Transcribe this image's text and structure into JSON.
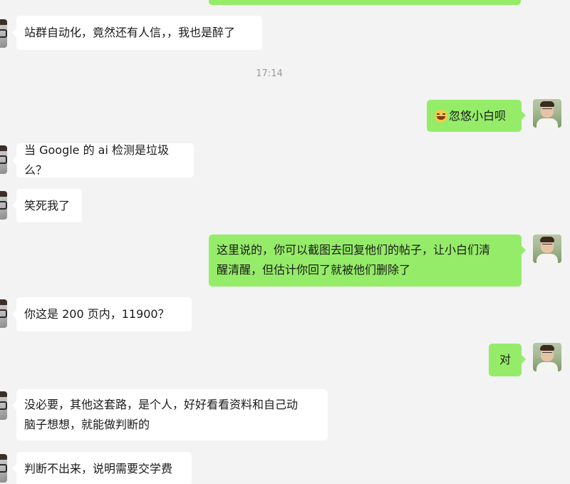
{
  "messages": [
    {
      "text": "站群自动化，竟然还有人信，，我也是醉了",
      "side": "left"
    },
    {
      "timestamp": "17:14"
    },
    {
      "text": "忽悠小白呗",
      "side": "right",
      "emoji": "laughing-tears-emoji"
    },
    {
      "text": "当 Google 的 ai 检测是垃圾么？",
      "side": "left"
    },
    {
      "text": "笑死我了",
      "side": "left"
    },
    {
      "text_lines": [
        "这里说的，你可以截图去回复他们的帖子，让小白们清",
        "醒清醒，但估计你回了就被他们删除了"
      ],
      "side": "right"
    },
    {
      "text": "你这是 200 页内，11900？",
      "side": "left"
    },
    {
      "text": "对",
      "side": "right"
    },
    {
      "text_lines": [
        "没必要，其他这套路，是个人，好好看看资料和自己动",
        "脑子想想，就能做判断的"
      ],
      "side": "left"
    },
    {
      "text": "判断不出来，说明需要交学费",
      "side": "left"
    }
  ],
  "colors": {
    "background": "#f3f3f3",
    "bubble_left": "#ffffff",
    "bubble_right": "#95ec69",
    "timestamp": "#9b9b9b"
  }
}
